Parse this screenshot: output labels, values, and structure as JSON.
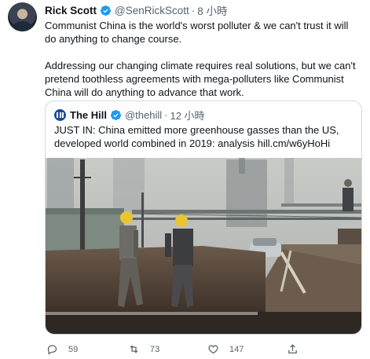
{
  "tweet": {
    "author_name": "Rick Scott",
    "handle": "@SenRickScott",
    "separator": "·",
    "time": "8 小時",
    "paragraph_1": "Communist China is the world's worst polluter & we can't trust it will do anything to change course.",
    "paragraph_2": "Addressing our changing climate requires real solutions, but we can't pretend toothless agreements with mega-polluters like Communist China will do anything to advance that work."
  },
  "quote": {
    "author_name": "The Hill",
    "handle": "@thehill",
    "separator": "·",
    "time": "12 小時",
    "text": "JUST IN: China emitted more greenhouse gasses than the US, developed world combined in 2019: analysis hill.cm/w6yHoHi"
  },
  "actions": {
    "reply_count": "59",
    "retweet_count": "73",
    "like_count": "147",
    "share_count": ""
  },
  "icons": {
    "verified": "verified-badge-icon",
    "reply": "reply-icon",
    "retweet": "retweet-icon",
    "like": "heart-icon",
    "share": "share-icon"
  },
  "colors": {
    "verified_blue": "#1d9bf0",
    "text_primary": "#0f1419",
    "text_secondary": "#536471",
    "border": "#cfd9de"
  }
}
